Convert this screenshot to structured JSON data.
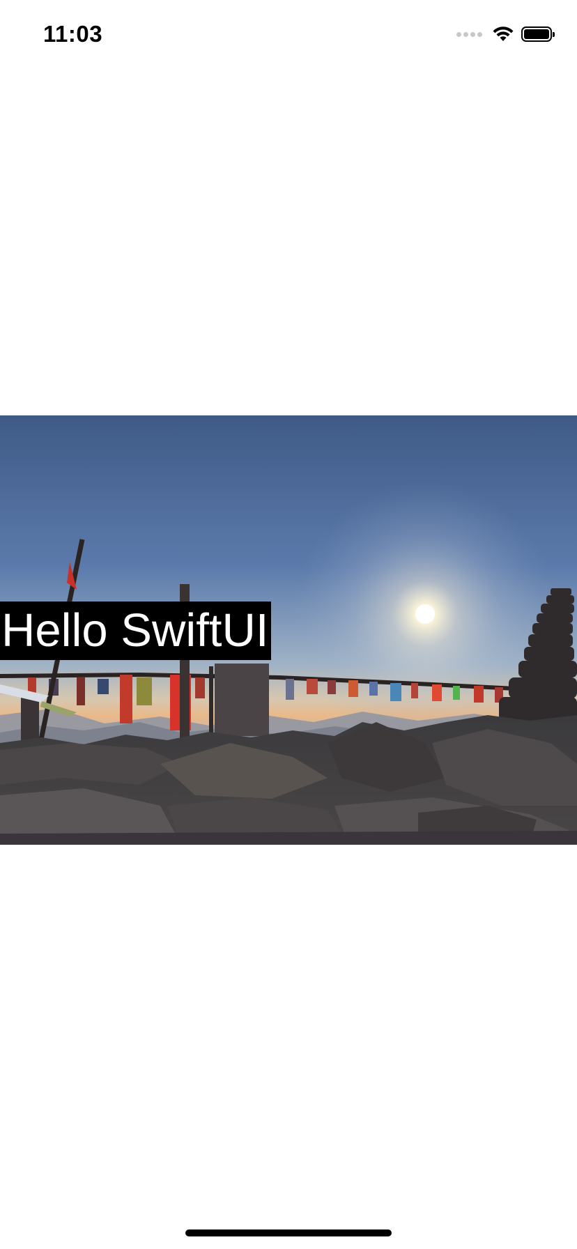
{
  "status_bar": {
    "time": "11:03",
    "icons": [
      "signal-dots-icon",
      "wifi-icon",
      "battery-icon"
    ]
  },
  "content": {
    "label": "Hello SwiftUI",
    "photo": "mountain summit at sunrise with prayer flags and rock cairn"
  },
  "colors": {
    "label_background": "#000000",
    "label_text": "#ffffff",
    "background": "#ffffff"
  }
}
